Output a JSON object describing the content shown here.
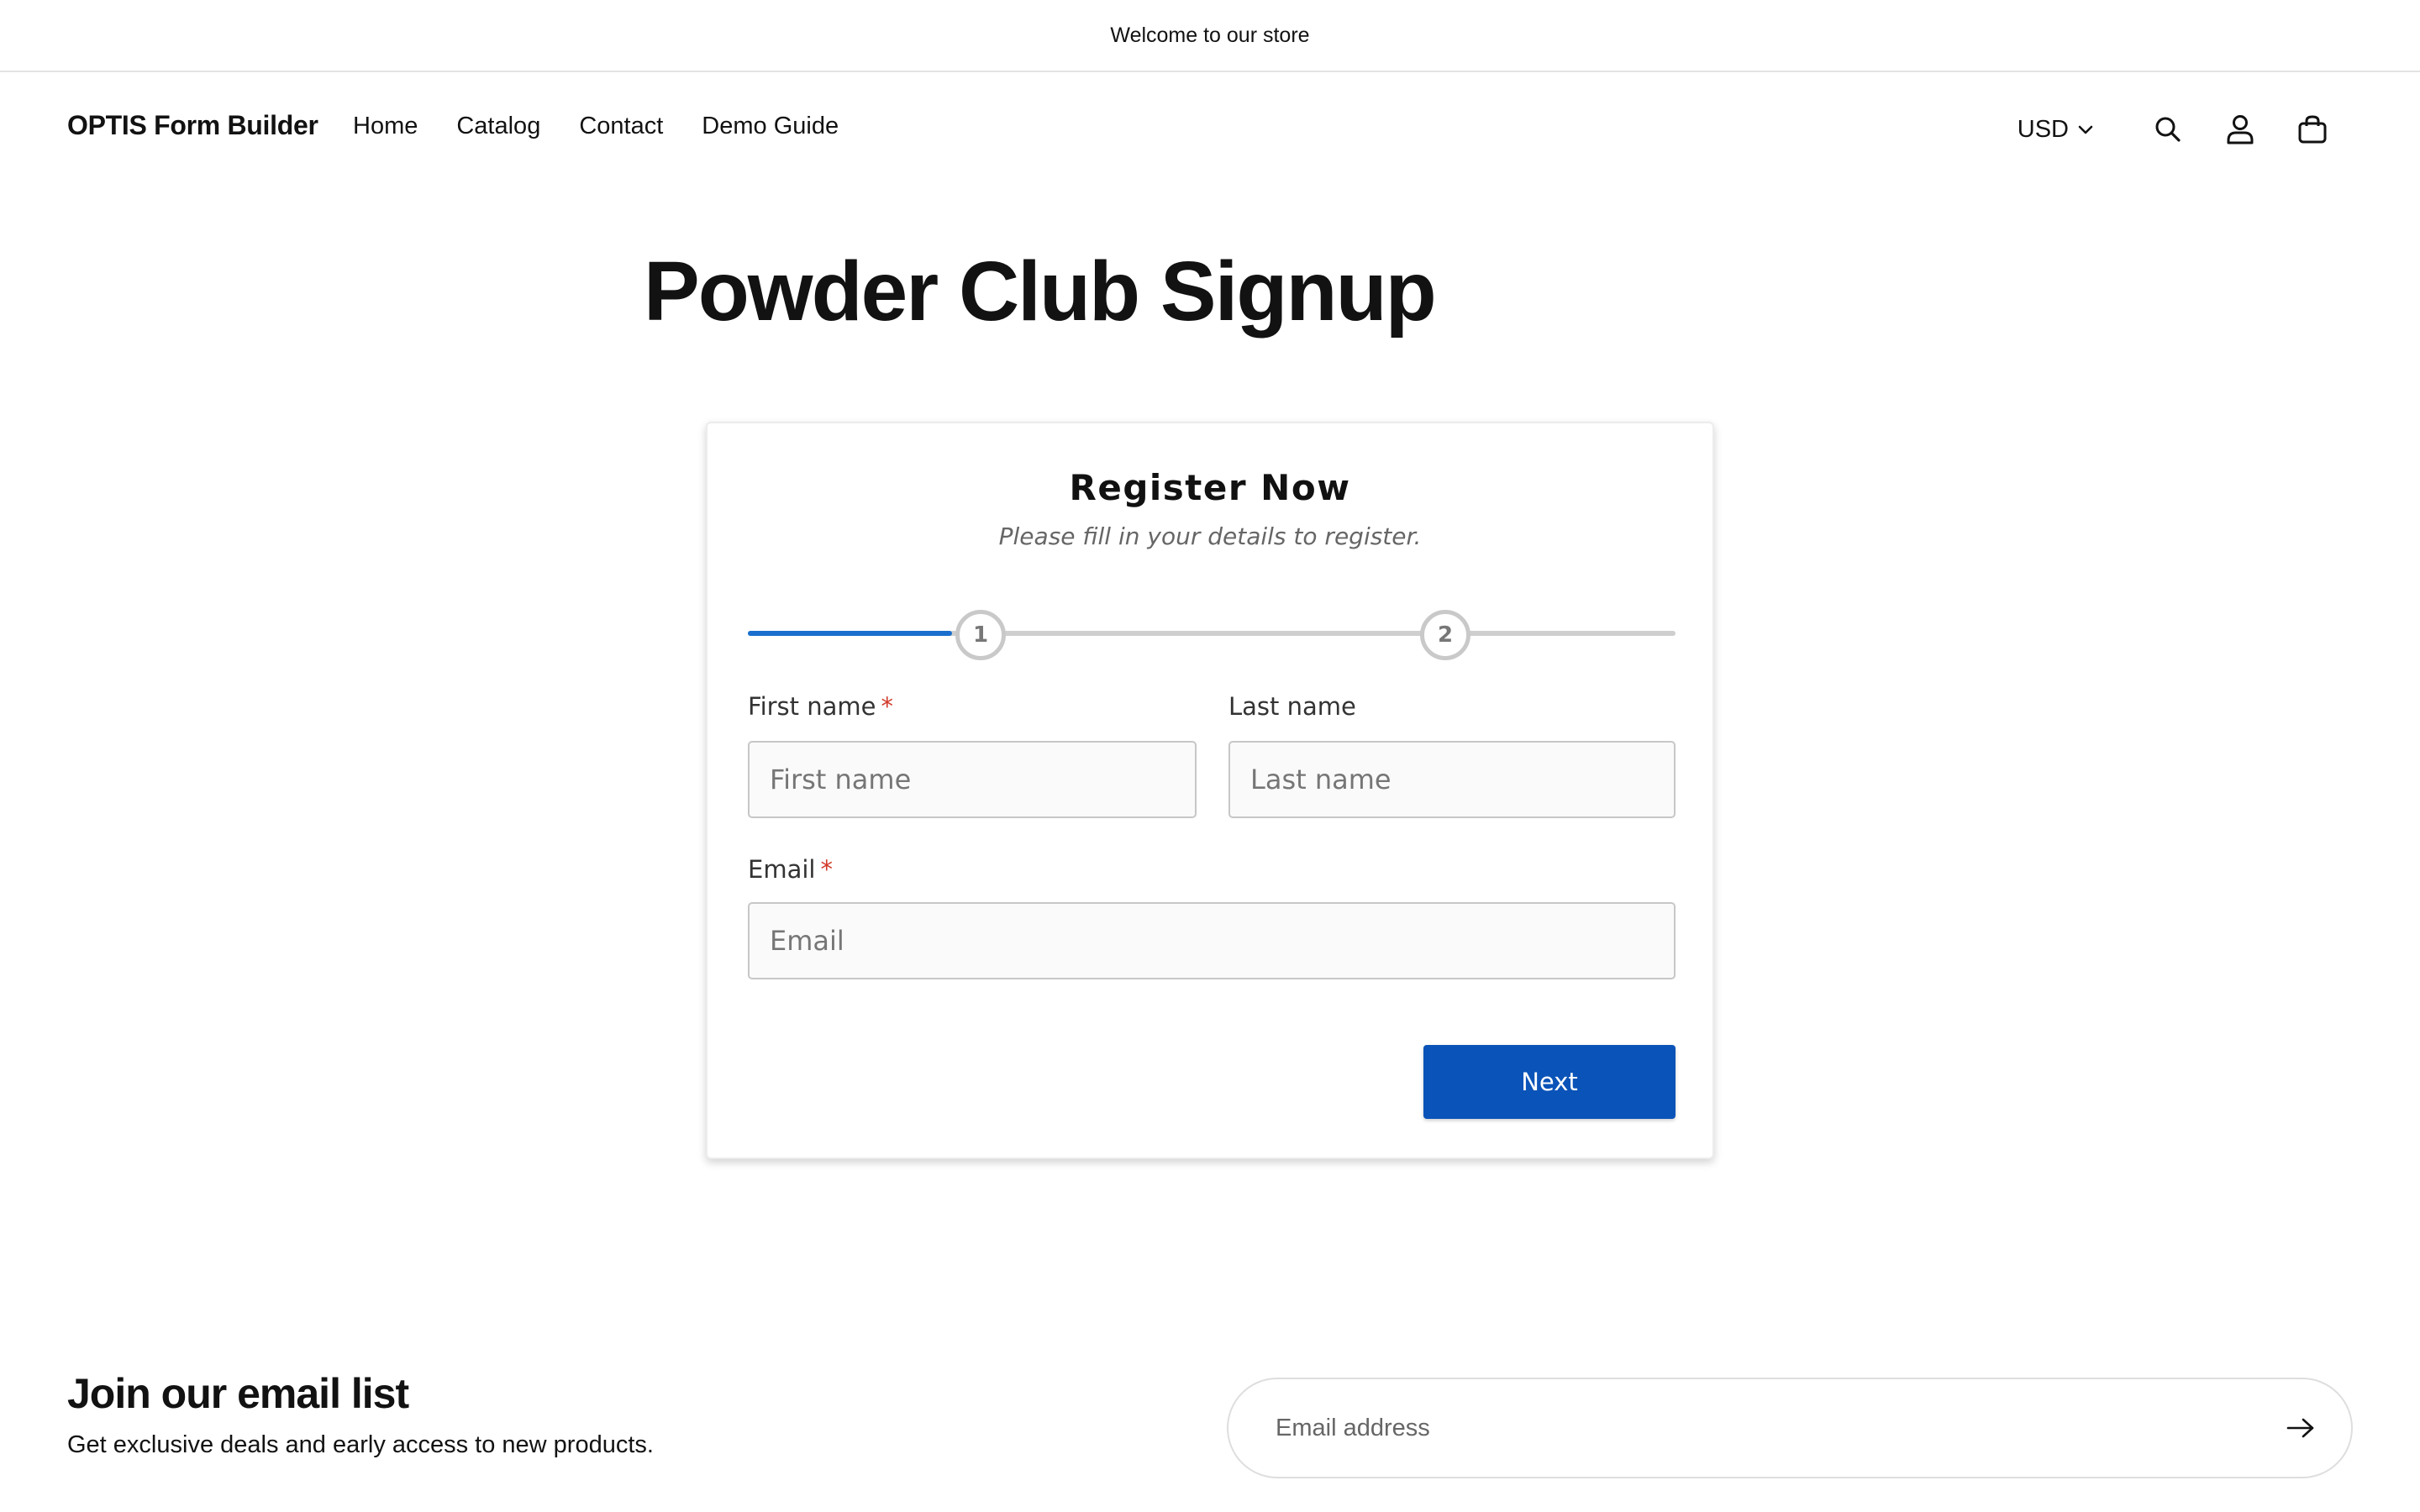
{
  "announcement": {
    "text": "Welcome to our store"
  },
  "header": {
    "logo": "OPTIS Form Builder",
    "nav": [
      {
        "label": "Home"
      },
      {
        "label": "Catalog"
      },
      {
        "label": "Contact"
      },
      {
        "label": "Demo Guide"
      }
    ],
    "currency": "USD",
    "icons": [
      "search-icon",
      "account-icon",
      "cart-icon"
    ]
  },
  "page": {
    "title": "Powder Club Signup"
  },
  "form": {
    "title": "Register Now",
    "subtitle": "Please fill in your details to register.",
    "steps": [
      "1",
      "2"
    ],
    "progress_percent": 22,
    "fields": {
      "first_name": {
        "label": "First name",
        "required_mark": "*",
        "placeholder": "First name",
        "value": ""
      },
      "last_name": {
        "label": "Last name",
        "placeholder": "Last name",
        "value": ""
      },
      "email": {
        "label": "Email",
        "required_mark": "*",
        "placeholder": "Email",
        "value": ""
      }
    },
    "next_label": "Next"
  },
  "newsletter": {
    "title": "Join our email list",
    "subtitle": "Get exclusive deals and early access to new products.",
    "placeholder": "Email address",
    "submit_icon": "arrow-right-icon"
  },
  "colors": {
    "accent": "#0a53b8",
    "progress": "#1a6fce",
    "required": "#d13a2a"
  }
}
